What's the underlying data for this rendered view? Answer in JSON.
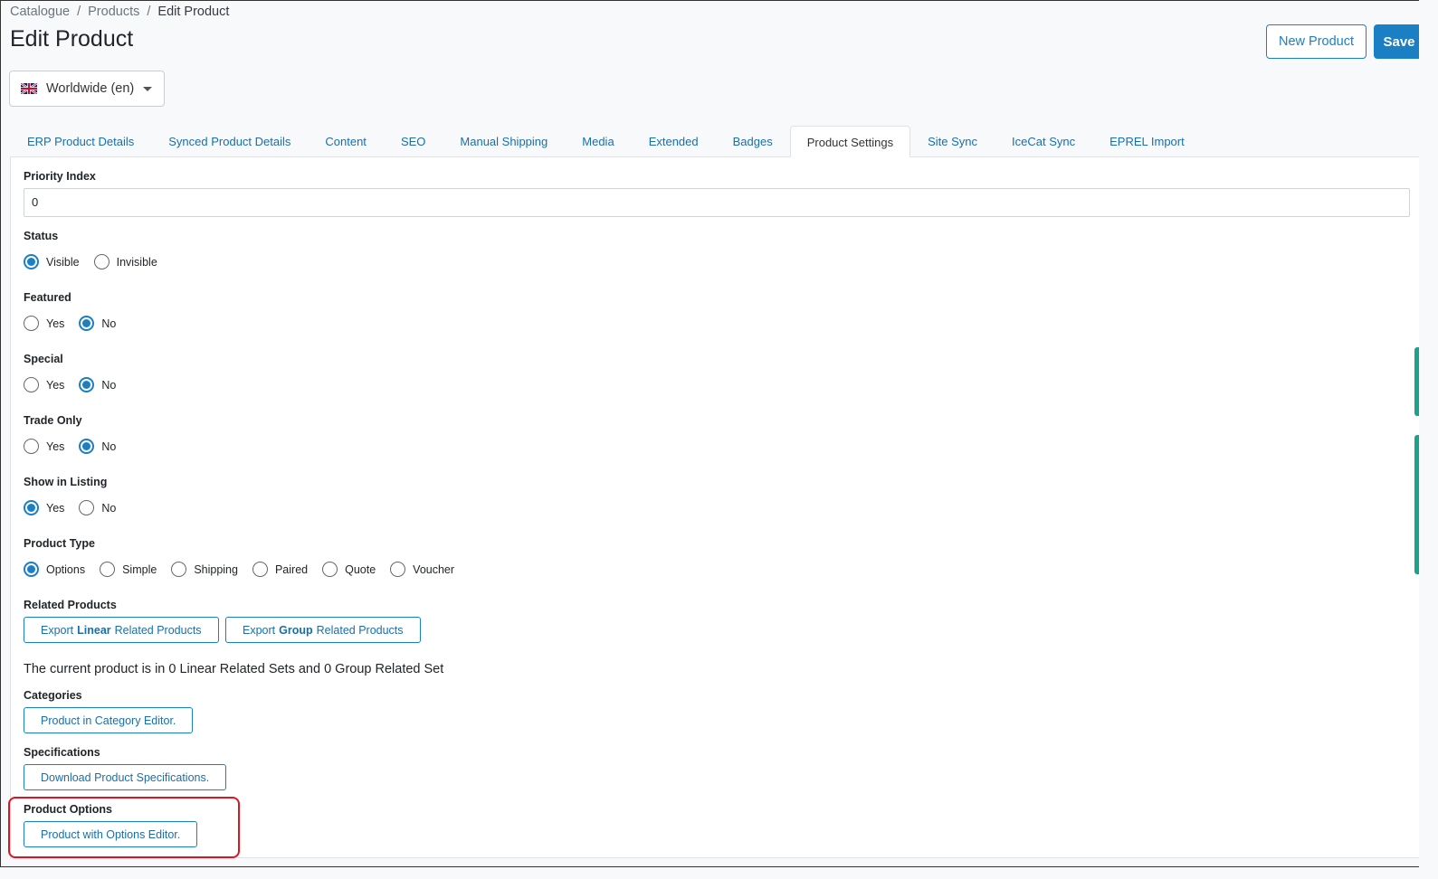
{
  "breadcrumb": {
    "items": [
      "Catalogue",
      "Products",
      "Edit Product"
    ],
    "sep": "/"
  },
  "page_title": "Edit Product",
  "header_buttons": {
    "new_product": "New Product",
    "save": "Save"
  },
  "locale": {
    "label": "Worldwide (en)",
    "flag": "uk-flag-icon"
  },
  "tabs": [
    {
      "label": "ERP Product Details"
    },
    {
      "label": "Synced Product Details"
    },
    {
      "label": "Content"
    },
    {
      "label": "SEO"
    },
    {
      "label": "Manual Shipping"
    },
    {
      "label": "Media"
    },
    {
      "label": "Extended"
    },
    {
      "label": "Badges"
    },
    {
      "label": "Product Settings",
      "active": true
    },
    {
      "label": "Site Sync"
    },
    {
      "label": "IceCat Sync"
    },
    {
      "label": "EPREL Import"
    }
  ],
  "form": {
    "priority_index": {
      "label": "Priority Index",
      "value": "0"
    },
    "status": {
      "label": "Status",
      "options": [
        "Visible",
        "Invisible"
      ],
      "selected": "Visible"
    },
    "featured": {
      "label": "Featured",
      "options": [
        "Yes",
        "No"
      ],
      "selected": "No"
    },
    "special": {
      "label": "Special",
      "options": [
        "Yes",
        "No"
      ],
      "selected": "No"
    },
    "trade_only": {
      "label": "Trade Only",
      "options": [
        "Yes",
        "No"
      ],
      "selected": "No"
    },
    "show_in_listing": {
      "label": "Show in Listing",
      "options": [
        "Yes",
        "No"
      ],
      "selected": "Yes"
    },
    "product_type": {
      "label": "Product Type",
      "options": [
        "Options",
        "Simple",
        "Shipping",
        "Paired",
        "Quote",
        "Voucher"
      ],
      "selected": "Options"
    },
    "related_products": {
      "label": "Related Products",
      "export_linear": {
        "pre": "Export",
        "bold": "Linear",
        "post": "Related Products"
      },
      "export_group": {
        "pre": "Export",
        "bold": "Group",
        "post": "Related Products"
      },
      "summary": "The current product is in 0 Linear Related Sets and 0 Group Related Set"
    },
    "categories": {
      "label": "Categories",
      "button": "Product in Category Editor."
    },
    "specifications": {
      "label": "Specifications",
      "button": "Download Product Specifications."
    },
    "product_options": {
      "label": "Product Options",
      "button": "Product with Options Editor."
    }
  }
}
